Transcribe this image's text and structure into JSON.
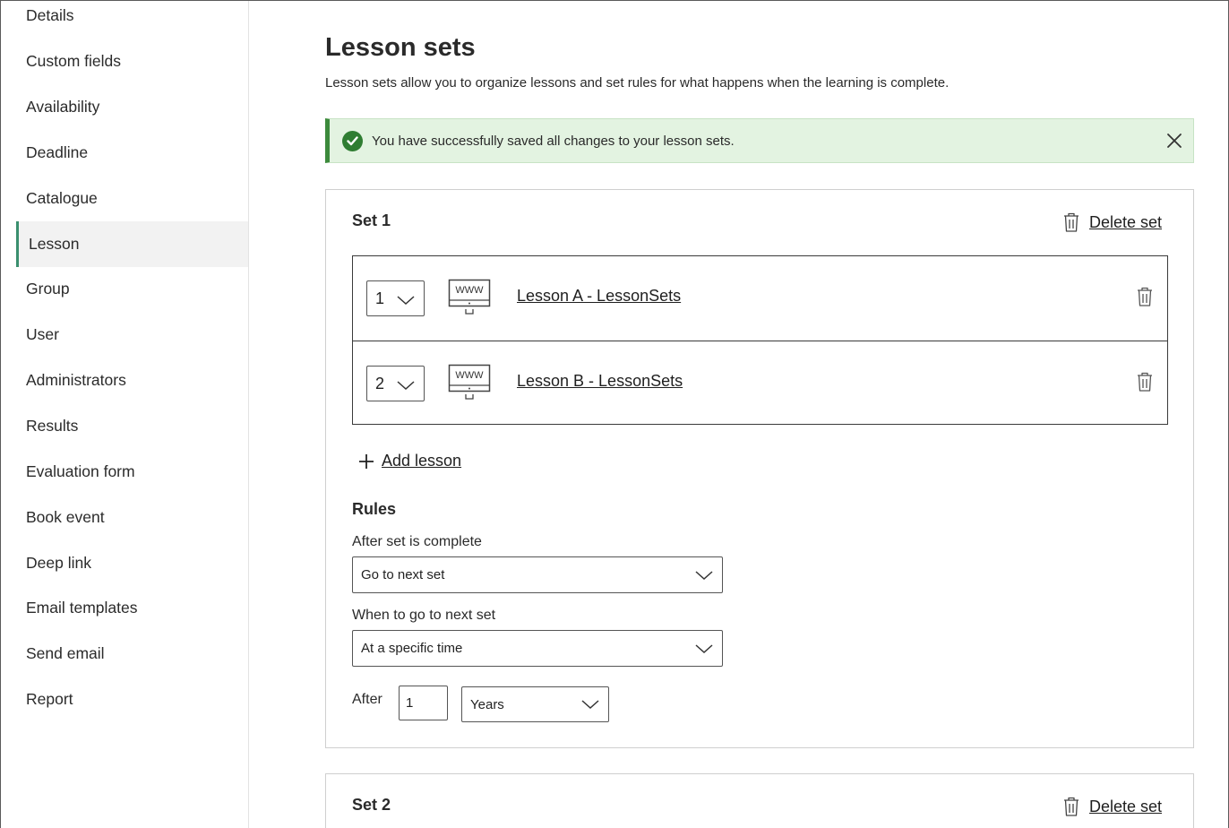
{
  "sidebar": {
    "items": [
      {
        "label": "Details"
      },
      {
        "label": "Custom fields"
      },
      {
        "label": "Availability"
      },
      {
        "label": "Deadline"
      },
      {
        "label": "Catalogue"
      },
      {
        "label": "Lesson",
        "active": true
      },
      {
        "label": "Group"
      },
      {
        "label": "User"
      },
      {
        "label": "Administrators"
      },
      {
        "label": "Results"
      },
      {
        "label": "Evaluation form"
      },
      {
        "label": "Book event"
      },
      {
        "label": "Deep link"
      },
      {
        "label": "Email templates"
      },
      {
        "label": "Send email"
      },
      {
        "label": "Report"
      }
    ],
    "active_accent": "#3a8f6e"
  },
  "main": {
    "title": "Lesson sets",
    "description": "Lesson sets allow you to organize lessons and set rules for what happens when the learning is complete.",
    "alert": {
      "text": "You have successfully saved all changes to your lesson sets.",
      "icon": "check-circle-icon",
      "close_icon": "close-icon",
      "color": "#2f7d32",
      "background": "#e3f3e1"
    },
    "sets": [
      {
        "title": "Set 1",
        "delete_label": "Delete set",
        "lessons": [
          {
            "order": "1",
            "name": "Lesson A - LessonSets",
            "icon": "www-monitor-icon"
          },
          {
            "order": "2",
            "name": "Lesson B - LessonSets",
            "icon": "www-monitor-icon"
          }
        ],
        "add_lesson_label": "Add lesson",
        "rules": {
          "title": "Rules",
          "after_complete_label": "After set is complete",
          "after_complete_value": "Go to next set",
          "when_label": "When to go to next set",
          "when_value": "At a specific time",
          "after_label": "After",
          "after_value": "1",
          "after_unit": "Years"
        }
      },
      {
        "title": "Set 2",
        "delete_label": "Delete set"
      }
    ]
  }
}
